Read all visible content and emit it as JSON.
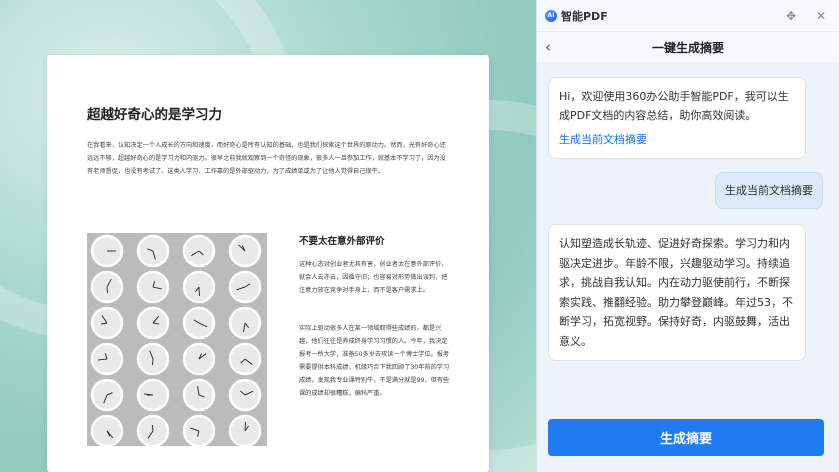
{
  "document": {
    "title": "超越好奇心的是学习力",
    "paragraph1": "在我看来，认知决定一个人成长的方向和速度，而好奇心是所有认知的基础，也是我们探索这个世界的原动力。然而，光有好奇心还远远不够，超越好奇心的是学习力和内驱力。很早之前我就观察到一个奇怪的现象，很多人一旦参加工作，就基本不学习了，因为没有老师督促，也没有考试了。这类人学习、工作靠的是外部驱动力，为了成绩单或为了让他人觉得自己很牛。",
    "subtitle": "不要太在意外部评价",
    "paragraph2": "这种心态对创业者尤其有害，创业者太在意外部评价，就会人云亦云，因循守旧；也容易对形势做出误判，把注意力放在竞争对手身上，而不是客户需求上。",
    "paragraph3": "实际上驱动很多人在某一领域取得些成绩的，都是兴趣，他们往往是养成终身学习习惯的人。今年，我决定报考一所大学，准备50多岁去攻读一个博士学位。报考需要提供本科成绩，机缘巧合下我回顾了30年前的学习成绩，发现我专业课特别牛，不是满分就是99，但有些课的成绩却很糟糕，偏科严重。"
  },
  "panel": {
    "logo_text": "AI",
    "app_title": "智能PDF",
    "move_icon": "✥",
    "close_icon": "✕",
    "back_icon": "‹",
    "header_title": "一键生成摘要",
    "greeting": "Hi，欢迎使用360办公助手智能PDF，我可以生成PDF文档的内容总结，助你高效阅读。",
    "greeting_link": "生成当前文档摘要",
    "user_message": "生成当前文档摘要",
    "summary": "认知塑造成长轨迹、促进好奇探索。学习力和内驱决定进步。年龄不限，兴趣驱动学习。持续追求，挑战自我认知。内在动力驱使前行，不断探索实践、推翻经验。助力攀登巅峰。年过53，不断学习，拓宽视野。保持好奇，内驱鼓舞，活出意义。",
    "generate_button": "生成摘要"
  }
}
